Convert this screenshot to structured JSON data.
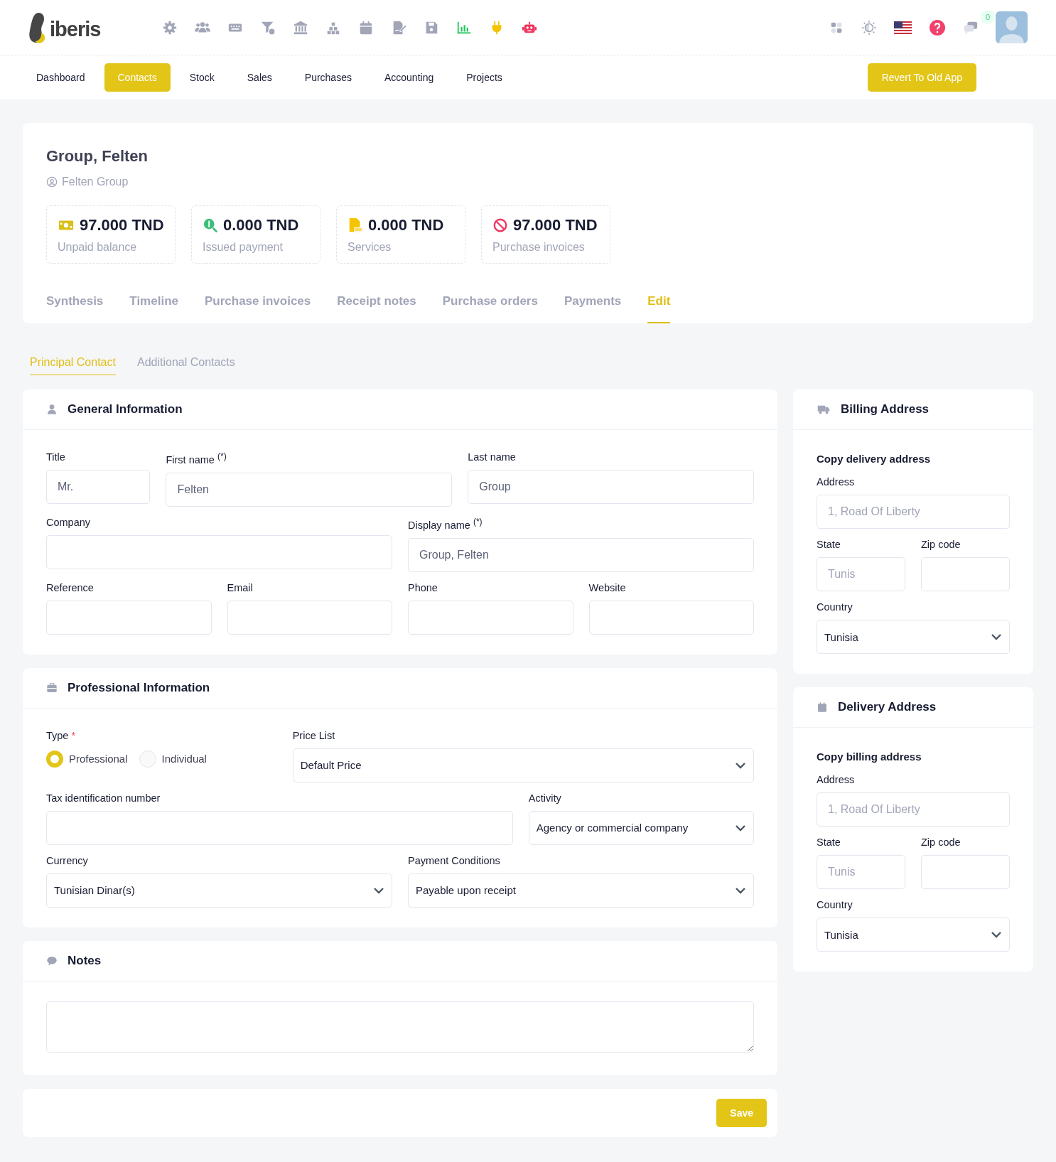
{
  "header": {
    "logo": "iberis",
    "notification_count": "0"
  },
  "nav": {
    "items": [
      {
        "label": "Dashboard",
        "selected": false
      },
      {
        "label": "Contacts",
        "selected": true
      },
      {
        "label": "Stock",
        "selected": false
      },
      {
        "label": "Sales",
        "selected": false
      },
      {
        "label": "Purchases",
        "selected": false
      },
      {
        "label": "Accounting",
        "selected": false
      },
      {
        "label": "Projects",
        "selected": false
      }
    ],
    "revert_button": "Revert To Old App"
  },
  "contact": {
    "name": "Group, Felten",
    "company": "Felten Group"
  },
  "stats": [
    {
      "kind": "cash",
      "amount": "97.000 TND",
      "label": "Unpaid balance"
    },
    {
      "kind": "search-money",
      "amount": "0.000 TND",
      "label": "Issued payment"
    },
    {
      "kind": "pdf",
      "amount": "0.000 TND",
      "label": "Services"
    },
    {
      "kind": "blocked",
      "amount": "97.000 TND",
      "label": "Purchase invoices"
    }
  ],
  "tabs": [
    {
      "label": "Synthesis",
      "selected": false
    },
    {
      "label": "Timeline",
      "selected": false
    },
    {
      "label": "Purchase invoices",
      "selected": false
    },
    {
      "label": "Receipt notes",
      "selected": false
    },
    {
      "label": "Purchase orders",
      "selected": false
    },
    {
      "label": "Payments",
      "selected": false
    },
    {
      "label": "Edit",
      "selected": true
    }
  ],
  "subtabs": [
    {
      "label": "Principal Contact",
      "selected": true
    },
    {
      "label": "Additional Contacts",
      "selected": false
    }
  ],
  "general": {
    "title": "General Information",
    "rows": [
      [
        {
          "kind": "input",
          "label": "Title",
          "value": "Mr."
        },
        {
          "kind": "input",
          "label": "First name $^{(*)}$",
          "value": "Felten"
        },
        {
          "kind": "input",
          "label": "Last name",
          "value": "Group"
        }
      ],
      [
        {
          "kind": "input",
          "label": "Company"
        },
        {
          "kind": "input",
          "label": "Display name $^{(*)}$",
          "value": "Group, Felten"
        }
      ],
      [
        {
          "kind": "input",
          "label": "Reference"
        },
        {
          "kind": "input",
          "label": "Email"
        },
        {
          "kind": "input",
          "label": "Phone"
        },
        {
          "kind": "input",
          "label": "Website"
        }
      ]
    ]
  },
  "professional": {
    "title": "Professional Information",
    "rows": [
      [
        {
          "kind": "radio",
          "label": "Type",
          "required_mark": "*",
          "options": [
            {
              "label": "Professional",
              "selected": true
            },
            {
              "label": "Individual",
              "selected": false
            }
          ]
        },
        {
          "kind": "select",
          "label": "Price List",
          "value": "Default Price"
        }
      ],
      [
        {
          "kind": "input",
          "label": "Tax identification number"
        },
        {
          "kind": "select",
          "label": "Activity",
          "value": "Agency or commercial company"
        }
      ],
      [
        {
          "kind": "select",
          "label": "Currency",
          "value": "Tunisian Dinar(s)"
        },
        {
          "kind": "select",
          "label": "Payment Conditions",
          "value": "Payable upon receipt"
        }
      ]
    ]
  },
  "notes": {
    "title": "Notes"
  },
  "addresses": [
    {
      "title": "Billing Address",
      "copy_link": "Copy delivery address",
      "rows": [
        [
          {
            "kind": "input",
            "label": "Address",
            "placeholder": "1, Road Of Liberty"
          }
        ],
        [
          {
            "kind": "input",
            "label": "State",
            "placeholder": "Tunis"
          },
          {
            "kind": "input",
            "label": "Zip code"
          }
        ],
        [
          {
            "kind": "select",
            "label": "Country",
            "value": "Tunisia"
          }
        ]
      ]
    },
    {
      "title": "Delivery Address",
      "copy_link": "Copy billing address",
      "rows": [
        [
          {
            "kind": "input",
            "label": "Address",
            "placeholder": "1, Road Of Liberty"
          }
        ],
        [
          {
            "kind": "input",
            "label": "State",
            "placeholder": "Tunis"
          },
          {
            "kind": "input",
            "label": "Zip code"
          }
        ],
        [
          {
            "kind": "select",
            "label": "Country",
            "value": "Tunisia"
          }
        ]
      ]
    }
  ],
  "save_button": "Save"
}
